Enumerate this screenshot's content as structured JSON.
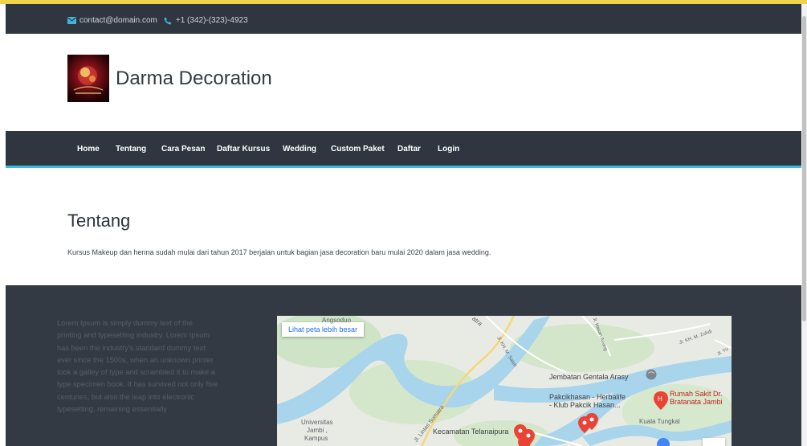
{
  "topbar": {
    "email": "contact@domain.com",
    "phone": "+1 (342)-(323)-4923",
    "email_icon": "envelope-icon",
    "phone_icon": "phone-icon"
  },
  "brand": {
    "name": "Darma Decoration",
    "logo": "darma-decoration-logo"
  },
  "nav": {
    "items": [
      "Home",
      "Tentang",
      "Cara Pesan",
      "Daftar Kursus",
      "Wedding",
      "Custom Paket",
      "Daftar",
      "Login"
    ]
  },
  "about": {
    "title": "Tentang",
    "text": "Kursus Makeup dan henna sudah mulai dari tahun 2017 berjalan untuk bagian jasa  decoration baru mulai 2020 dalam jasa wedding."
  },
  "footer": {
    "lorem": "Lorem Ipsum is simply dummy text of the printing and typesetting industry. Lorem Ipsum has been the industry's standard dummy text ever since the 1500s, when an unknown printer took a galley of type and scrambled it to make a type specimen book. It has survived not only five centuries, but also the leap into electronic typesetting, remaining essentially"
  },
  "map": {
    "link_label": "Lihat peta lebih besar",
    "labels": {
      "bridge": "Jembatan Gentala Arasy",
      "pakcik_1": "Pakcikhasan - Herbalife",
      "pakcik_2": "- Klub Pakcik Hasan...",
      "hospital_1": "Rumah Sakit Dr.",
      "hospital_2": "Bratanata Jambi",
      "kuala": "Kuala Tungkal",
      "univ_1": "Universitas",
      "univ_2": "Jambi ,",
      "univ_3": "Kampus",
      "kecamatan": "Kecamatan Telanaipura",
      "road_sumatra": "Jl. Lintas Sumatra",
      "road_atra": "atra",
      "road_hasan": "Jl. KH. M. Zuhdi",
      "road_salam": "Jl. KH. M. Saleh",
      "road_top": "Jl. Hasan Anang",
      "road_yu": "Jl. Yu",
      "top_left_place": "Angsoduo"
    }
  },
  "colors": {
    "dark": "#2f3640",
    "accent_line": "#3fb7d9",
    "gold_line": "#efd44a",
    "river": "#a8d4ec",
    "pin": "#ea4335",
    "link": "#1a73e8"
  }
}
